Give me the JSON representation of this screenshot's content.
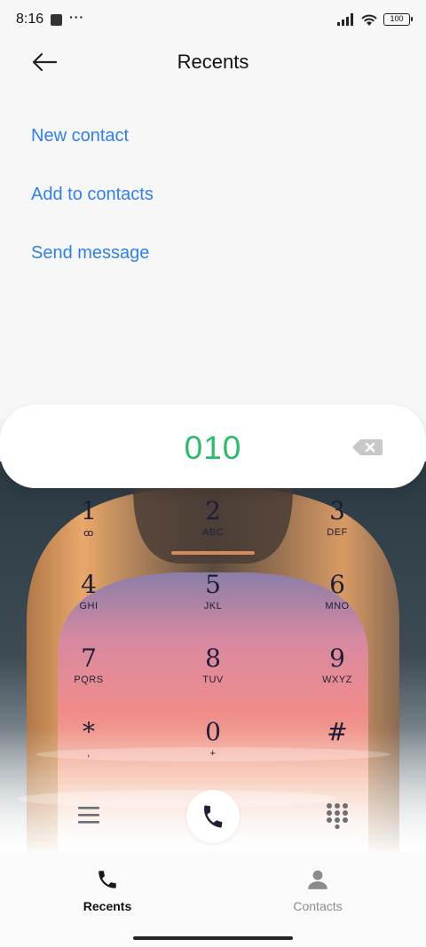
{
  "status_bar": {
    "time": "8:16",
    "battery": "100"
  },
  "header": {
    "title": "Recents"
  },
  "actions": {
    "new_contact": "New contact",
    "add_to_contacts": "Add to contacts",
    "send_message": "Send message"
  },
  "dialer": {
    "number": "010"
  },
  "keys": [
    {
      "digit": "1",
      "letters": "ꝏ"
    },
    {
      "digit": "2",
      "letters": "ABC"
    },
    {
      "digit": "3",
      "letters": "DEF"
    },
    {
      "digit": "4",
      "letters": "GHI"
    },
    {
      "digit": "5",
      "letters": "JKL"
    },
    {
      "digit": "6",
      "letters": "MNO"
    },
    {
      "digit": "7",
      "letters": "PQRS"
    },
    {
      "digit": "8",
      "letters": "TUV"
    },
    {
      "digit": "9",
      "letters": "WXYZ"
    },
    {
      "digit": "*",
      "letters": ","
    },
    {
      "digit": "0",
      "letters": "+"
    },
    {
      "digit": "#",
      "letters": ""
    }
  ],
  "bottom_nav": {
    "recents": "Recents",
    "contacts": "Contacts"
  },
  "colors": {
    "accent_link": "#2f80ed",
    "dialed_number": "#2dbb6a"
  }
}
